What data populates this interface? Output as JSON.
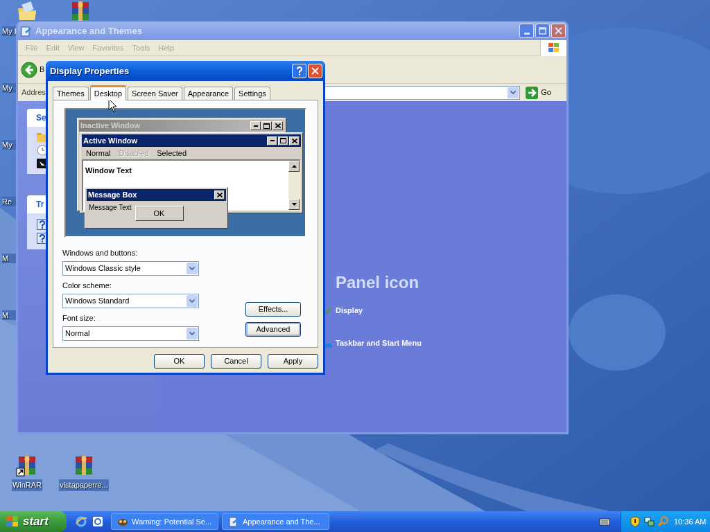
{
  "desktop": {
    "side_labels": [
      "My I",
      "My",
      "My",
      "Re",
      "M",
      "M"
    ],
    "icons": [
      {
        "label": "WinRAR",
        "shortcut": true
      },
      {
        "label": "vistapaperre...",
        "shortcut": false
      }
    ]
  },
  "explorer": {
    "title": "Appearance and Themes",
    "active": false,
    "menu": [
      "File",
      "Edit",
      "View",
      "Favorites",
      "Tools",
      "Help"
    ],
    "back_label": "B",
    "address_label": "Addres",
    "go_label": "Go",
    "panels": [
      {
        "title": "Se",
        "kind": "tasks"
      },
      {
        "title": "Tr",
        "kind": "help"
      }
    ],
    "heading": "Panel icon",
    "links": [
      "Display",
      "Taskbar and Start Menu"
    ]
  },
  "dialog": {
    "title": "Display Properties",
    "tabs": [
      {
        "label": "Themes",
        "selected": false
      },
      {
        "label": "Desktop",
        "selected": true
      },
      {
        "label": "Screen Saver",
        "selected": false
      },
      {
        "label": "Appearance",
        "selected": false
      },
      {
        "label": "Settings",
        "selected": false
      }
    ],
    "preview": {
      "inactive_title": "Inactive Window",
      "active_title": "Active Window",
      "menu": [
        {
          "label": "Normal",
          "disabled": false
        },
        {
          "label": "Disabled",
          "disabled": true
        },
        {
          "label": "Selected",
          "disabled": false
        }
      ],
      "window_text": "Window Text",
      "message_title": "Message Box",
      "message_text": "Message Text",
      "message_button": "OK"
    },
    "fields": [
      {
        "label": "Windows and buttons:",
        "value": "Windows Classic style"
      },
      {
        "label": "Color scheme:",
        "value": "Windows Standard"
      },
      {
        "label": "Font size:",
        "value": "Normal"
      }
    ],
    "side_buttons": [
      {
        "label": "Effects...",
        "focused": false
      },
      {
        "label": "Advanced",
        "focused": true
      }
    ],
    "buttons": [
      "OK",
      "Cancel",
      "Apply"
    ]
  },
  "taskbar": {
    "start": "start",
    "tasks": [
      {
        "label": "Warning: Potential Se...",
        "selected": false
      },
      {
        "label": "Appearance and The...",
        "selected": false
      }
    ],
    "clock": "10:36 AM"
  }
}
